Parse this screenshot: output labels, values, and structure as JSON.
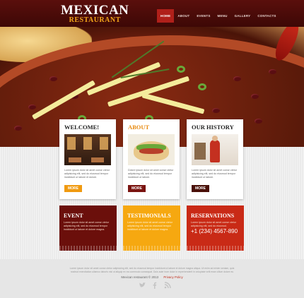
{
  "brand": {
    "title": "MEXICAN",
    "subtitle": "RESTAURANT"
  },
  "nav": [
    "HOME",
    "ABOUT",
    "EVENTS",
    "MENU",
    "GALLERY",
    "CONTACTS"
  ],
  "cards": [
    {
      "title": "WELCOME!",
      "text": "Lorem ipsum dolor sit amet conse ctetur adipisicing elit, sed do eiusmod tempor incididunt ut labore et dolore.",
      "button": "MORE"
    },
    {
      "title": "ABOUT",
      "text": "Dolore ipsum dolor sit amet conse ctetur adipisicing elit, sed do eiusmod tempor incididunt ut labore.",
      "button": "MORE"
    },
    {
      "title": "OUR HISTORY",
      "text": "Lorem ipsum dolor sit amet conse ctetur adipisicing elit, sed do eiusmod tempor incididunt ut labore.",
      "button": "MORE"
    }
  ],
  "boxes": [
    {
      "title": "EVENT",
      "text": "Lorem ipsum dolor sit amet conse ctetur adipisicing elit, sed do eiusmod tempor incididunt ut labore et dolore magna."
    },
    {
      "title": "TESTIMONIALS",
      "text": "Lorem ipsum dolor sit amet conse ctetur adipisicing elit, sed do eiusmod tempor incididunt ut labore et dolore magna."
    },
    {
      "title": "RESERVATIONS",
      "text": "Lorem ipsum dolor sit amet conse ctetur adipisicing elit, sed do eiusmod.",
      "phone": "+1 (234) 4567-890"
    }
  ],
  "footer": {
    "text": "Lorem ipsum dolor sit amet conse ctetur adipisicing elit, sed do eiusmod tempor incididunt ut labore et dolore magna aliqua. Ut enim ad minim veniam, quis nostrud exercitation ullamco laboris nisi ut aliquip ex ea commodo consequat. Duis aute irure dolor in reprehenderit in voluptate velit esse cillum dolore eu fugiat nulla pariatur.",
    "copyright": "Mexican restaurant © 2013",
    "privacy": "Privacy Policy",
    "social_icons": [
      "twitter-icon",
      "facebook-icon",
      "rss-icon"
    ]
  },
  "colors": {
    "header": "#4a0c09",
    "accent_red": "#b0201a",
    "orange": "#f09a10",
    "maroon": "#6b0f0b"
  }
}
